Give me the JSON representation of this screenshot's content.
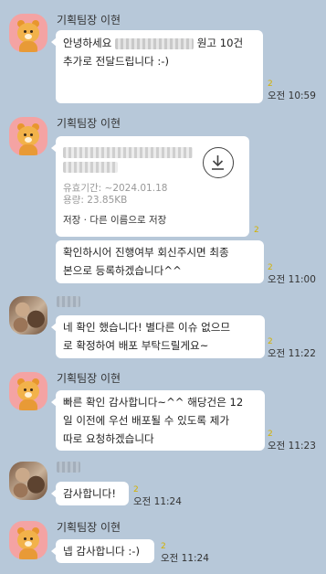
{
  "sender_bot": "기획팀장 이현",
  "messages": {
    "m1": {
      "text_a": "안녕하세요",
      "text_b": "원고 10건",
      "line2": "추가로 전달드립니다 :-)",
      "unread": "2",
      "time": "오전 10:59"
    },
    "file": {
      "expiry": "유효기간: ~2024.01.18",
      "size": "용량: 23.85KB",
      "save": "저장",
      "separator": "·",
      "save_as": "다른 이름으로 저장",
      "unread": "2"
    },
    "m2": {
      "line1": "확인하시어 진행여부 회신주시면 최종",
      "line2": "본으로 등록하겠습니다^^",
      "unread": "2",
      "time": "오전 11:00"
    },
    "m3": {
      "line1": "네 확인 했습니다! 별다른 이슈 없으므",
      "line2": "로 확정하여 배포 부탁드릴게요~",
      "unread": "2",
      "time": "오전 11:22"
    },
    "m4": {
      "line1": "빠른 확인 감사합니다~^^ 해당건은 12",
      "line2": "일 이전에 우선 배포될 수 있도록 제가",
      "line3": "따로 요청하겠습니다",
      "unread": "2",
      "time": "오전 11:23"
    },
    "m5": {
      "text": "감사합니다!",
      "unread": "2",
      "time": "오전 11:24"
    },
    "m6": {
      "text": "넵 감사합니다 :-)",
      "unread": "2",
      "time": "오전 11:24"
    }
  },
  "colors": {
    "background": "#b7c8d9",
    "bubble": "#ffffff",
    "unread": "#d3b100",
    "bot_avatar": "#f4a3a3"
  },
  "icons": {
    "download": "download-arrow-icon",
    "bot_avatar": "ryan-bear-avatar",
    "user_avatar": "blurred-photo-avatar"
  }
}
